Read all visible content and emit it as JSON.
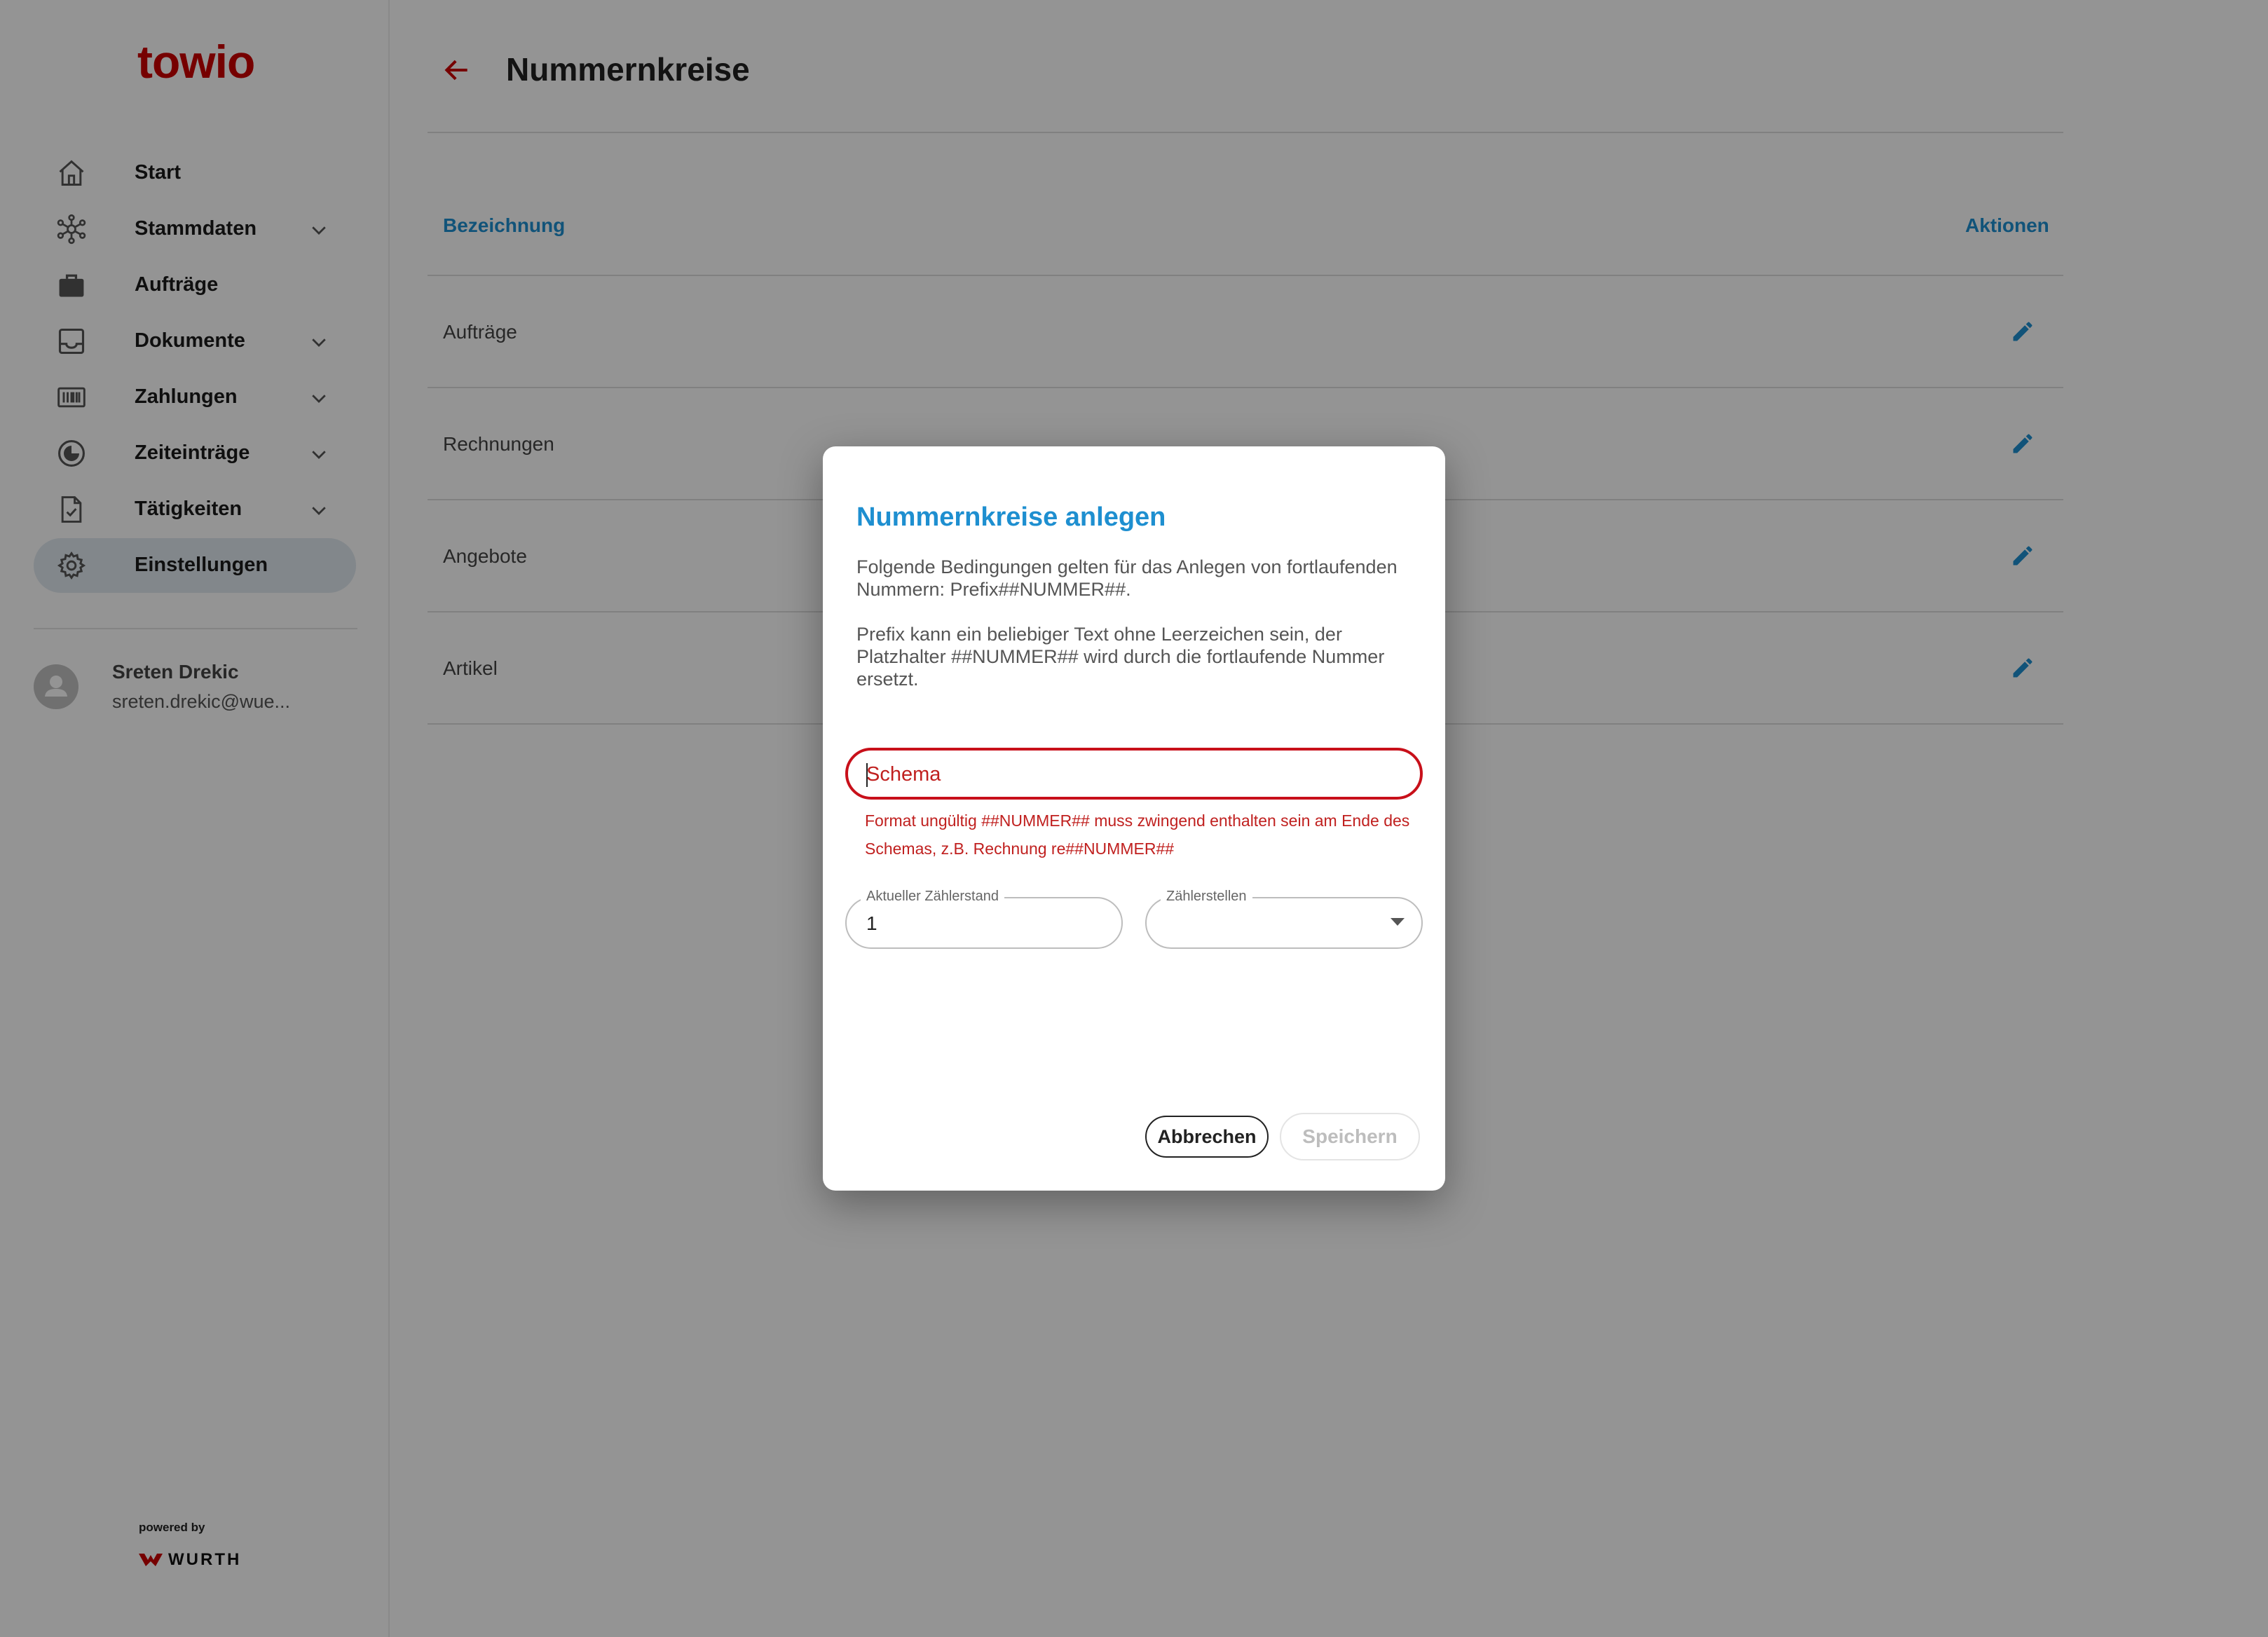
{
  "app": {
    "logo": "towio"
  },
  "sidebar": {
    "items": [
      {
        "label": "Start",
        "icon": "home-icon",
        "expandable": false,
        "active": false
      },
      {
        "label": "Stammdaten",
        "icon": "network-icon",
        "expandable": true,
        "active": false
      },
      {
        "label": "Aufträge",
        "icon": "briefcase-icon",
        "expandable": false,
        "active": false
      },
      {
        "label": "Dokumente",
        "icon": "inbox-icon",
        "expandable": true,
        "active": false
      },
      {
        "label": "Zahlungen",
        "icon": "barcode-icon",
        "expandable": true,
        "active": false
      },
      {
        "label": "Zeiteinträge",
        "icon": "clock-icon",
        "expandable": true,
        "active": false
      },
      {
        "label": "Tätigkeiten",
        "icon": "task-file-icon",
        "expandable": true,
        "active": false
      },
      {
        "label": "Einstellungen",
        "icon": "gear-icon",
        "expandable": false,
        "active": true
      }
    ],
    "user": {
      "name": "Sreten Drekic",
      "email": "sreten.drekic@wue..."
    },
    "footer": {
      "powered_by": "powered by",
      "brand": "WURTH"
    }
  },
  "main": {
    "title": "Nummernkreise",
    "table": {
      "headers": {
        "name": "Bezeichnung",
        "actions": "Aktionen"
      },
      "rows": [
        {
          "label": "Aufträge"
        },
        {
          "label": "Rechnungen"
        },
        {
          "label": "Angebote"
        },
        {
          "label": "Artikel"
        }
      ]
    }
  },
  "dialog": {
    "title": "Nummernkreise anlegen",
    "description_1": "Folgende Bedingungen gelten für das Anlegen von fortlaufenden Nummern: Prefix##NUMMER##.",
    "description_2": "Prefix kann ein beliebiger Text ohne Leerzeichen sein, der Platzhalter ##NUMMER## wird durch die fortlaufende Nummer ersetzt.",
    "schema": {
      "placeholder": "Schema",
      "value": "",
      "error": "Format ungültig ##NUMMER## muss zwingend enthalten sein am Ende des Schemas, z.B. Rechnung re##NUMMER##"
    },
    "counter": {
      "label": "Aktueller Zählerstand",
      "value": "1"
    },
    "digits": {
      "label": "Zählerstellen",
      "value": ""
    },
    "buttons": {
      "cancel": "Abbrechen",
      "save": "Speichern"
    }
  },
  "colors": {
    "brand_red": "#cc0000",
    "accent_blue": "#1e8fd0",
    "error_red": "#c0201f",
    "active_nav_bg": "#e1e9ef"
  }
}
